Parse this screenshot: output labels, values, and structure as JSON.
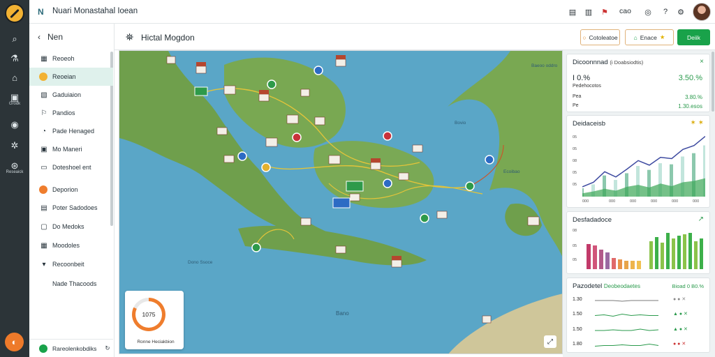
{
  "app": {
    "brand_mark": "N",
    "title": "Nuari Monastahal Ioean"
  },
  "rail": {
    "items": [
      {
        "label": "",
        "icon": "search-icon"
      },
      {
        "label": "",
        "icon": "flask-icon"
      },
      {
        "label": "",
        "icon": "building-icon"
      },
      {
        "label": "Grodk",
        "icon": "camera-icon"
      },
      {
        "label": "",
        "icon": "chat-icon"
      },
      {
        "label": "",
        "icon": "settings-icon"
      },
      {
        "label": "Reseaick",
        "icon": "rocket-icon"
      }
    ],
    "fab_icon": "compass-icon"
  },
  "topbar": {
    "icons": [
      "document-icon",
      "briefcase-icon",
      "alert-icon",
      "globe-icon",
      "help-icon",
      "settings-icon"
    ],
    "status_text": "cao"
  },
  "subnav": {
    "back_label": "Nen",
    "items": [
      {
        "label": "Reoeoh",
        "icon": "chart-icon"
      },
      {
        "label": "Reoeian",
        "icon": "circle-icon",
        "active": true
      },
      {
        "label": "Gaduiaion",
        "icon": "image-icon"
      },
      {
        "label": "Pandios",
        "icon": "flag-icon"
      },
      {
        "label": "Pade Henaged",
        "icon": "gauge-icon"
      },
      {
        "label": "Mo Maneri",
        "icon": "server-icon"
      },
      {
        "label": "Doteshoel ent",
        "icon": "calendar-icon"
      },
      {
        "label": "Deporion",
        "icon": "orange-dot-icon"
      },
      {
        "label": "Poter Sadodoes",
        "icon": "table-icon"
      },
      {
        "label": "Do Medoks",
        "icon": "box-icon"
      },
      {
        "label": "Moodoles",
        "icon": "grid-icon"
      },
      {
        "label": "Recoonbeit",
        "icon": "chevron-icon"
      },
      {
        "label": "Nade Thacoods",
        "icon": ""
      }
    ],
    "footer_label": "Rareolenkobdiks"
  },
  "map_header": {
    "title": "Hictal Mogdon",
    "btn_secondary": "Cotoleatoe",
    "btn_share": "Enace",
    "btn_primary": "Deiik"
  },
  "map": {
    "labels": [
      "Baeoo oddro",
      "Bovio",
      "Ecoibao",
      "Dono Ssoce",
      "Bano"
    ],
    "mini_value": "1075",
    "mini_label": "Ronne Heciakbion",
    "progress": 0.82
  },
  "cards": {
    "kpi": {
      "title": "Dicoonnnad",
      "subtitle": "(i Doabsiodtis)",
      "v1": "I 0.%",
      "v1_green": "3.50.%",
      "sub1": "Pedehocotos",
      "v2_label": "Pea",
      "v2_green": "3.80.%",
      "sub2": "Pe",
      "v3_green": "1.30.esos"
    },
    "area": {
      "title": "Deidaceisb",
      "y_ticks": [
        "05",
        "05",
        "08",
        "05",
        "05"
      ],
      "x_ticks": [
        "000",
        "000",
        "000",
        "000",
        "000",
        "000"
      ]
    },
    "bars": {
      "title": "Desfadadoce",
      "y_ticks": [
        "08",
        "05",
        "05"
      ]
    },
    "table": {
      "title": "Pazodetel",
      "title_green": "Deobeodaetes",
      "tag_green": "Bioad 0 B0.%",
      "rows": [
        "1.30",
        "1.50",
        "1.50",
        "1.80"
      ]
    }
  },
  "chart_data": [
    {
      "type": "area",
      "title": "Deidaceisb",
      "series": [
        {
          "values": [
            15,
            22,
            38,
            30,
            42,
            55,
            48,
            60,
            58,
            72,
            78,
            92
          ]
        },
        {
          "values": [
            5,
            8,
            12,
            9,
            15,
            18,
            14,
            20,
            16,
            22,
            24,
            28
          ]
        }
      ]
    },
    {
      "type": "bar",
      "title": "Desfadadoce",
      "series": [
        {
          "values": [
            36,
            34,
            28,
            24,
            16,
            14,
            12,
            12,
            12
          ]
        },
        {
          "values": [
            40,
            46,
            38,
            52,
            44,
            48,
            50,
            52,
            40,
            44
          ]
        }
      ]
    }
  ],
  "colors": {
    "accent": "#19a24a",
    "orange": "#ef7d2d",
    "sea": "#5aa6c7",
    "land": "#6f9f4c"
  }
}
